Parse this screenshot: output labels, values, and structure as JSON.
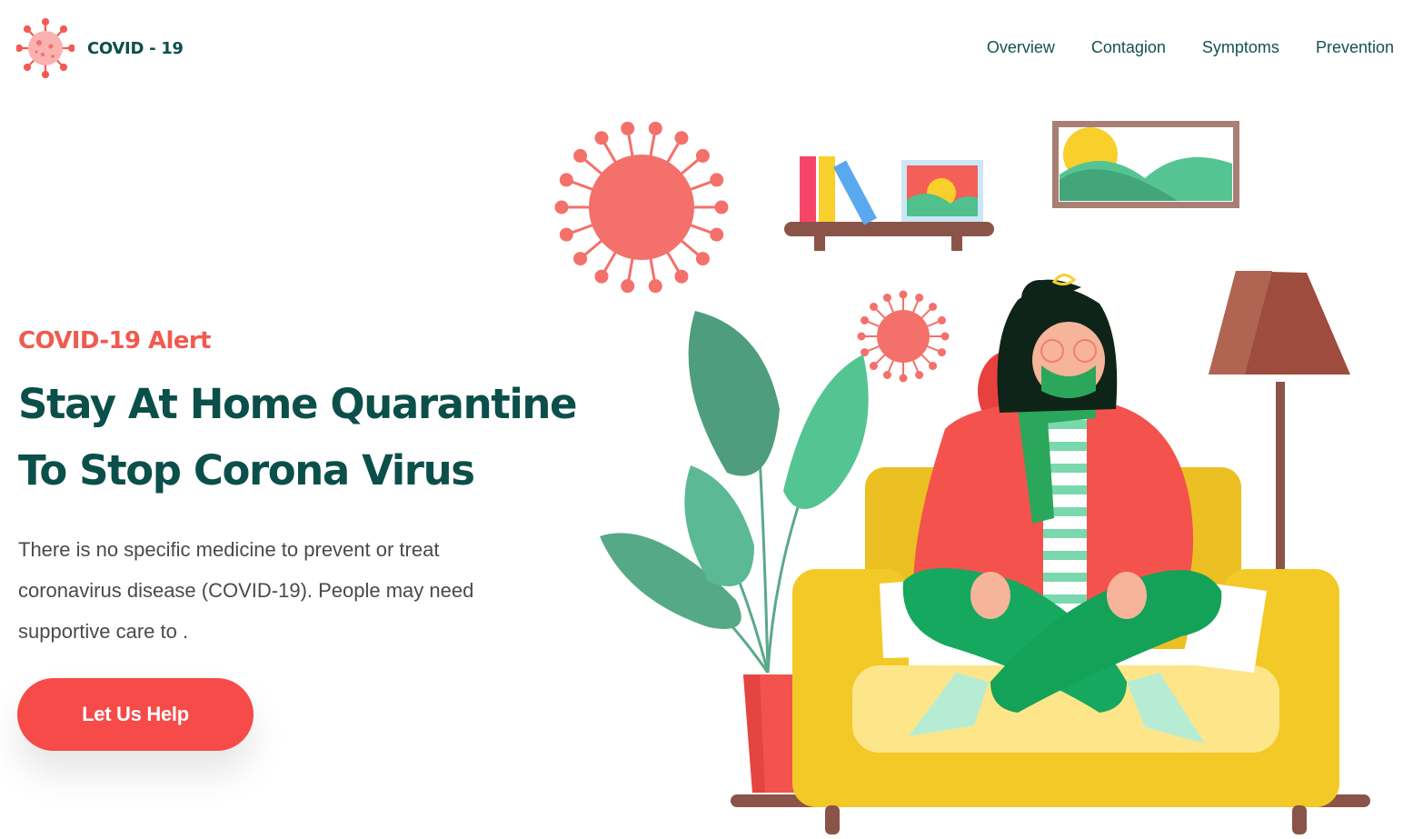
{
  "brand": {
    "name": "COVID - 19",
    "logo_icon": "virus-icon"
  },
  "nav": {
    "items": [
      {
        "label": "Overview"
      },
      {
        "label": "Contagion"
      },
      {
        "label": "Symptoms"
      },
      {
        "label": "Prevention"
      }
    ]
  },
  "hero": {
    "eyebrow": "COVID-19 Alert",
    "headline_line1": "Stay At Home Quarantine",
    "headline_line2": "To Stop Corona Virus",
    "lead": "There is no specific medicine to prevent or treat coronavirus disease (COVID-19). People may need supportive care to .",
    "cta_label": "Let Us Help"
  },
  "illustration": {
    "subject": "woman-on-sofa-illustration",
    "elements": [
      "virus-icon",
      "shelf",
      "books",
      "picture-frame",
      "landscape-painting",
      "potted-plant",
      "floor-lamp",
      "sofa"
    ]
  },
  "colors": {
    "brand_dark": "#0b4f4a",
    "accent": "#f05a4f",
    "cta": "#f64b48",
    "text_muted": "#4a4a4a"
  }
}
